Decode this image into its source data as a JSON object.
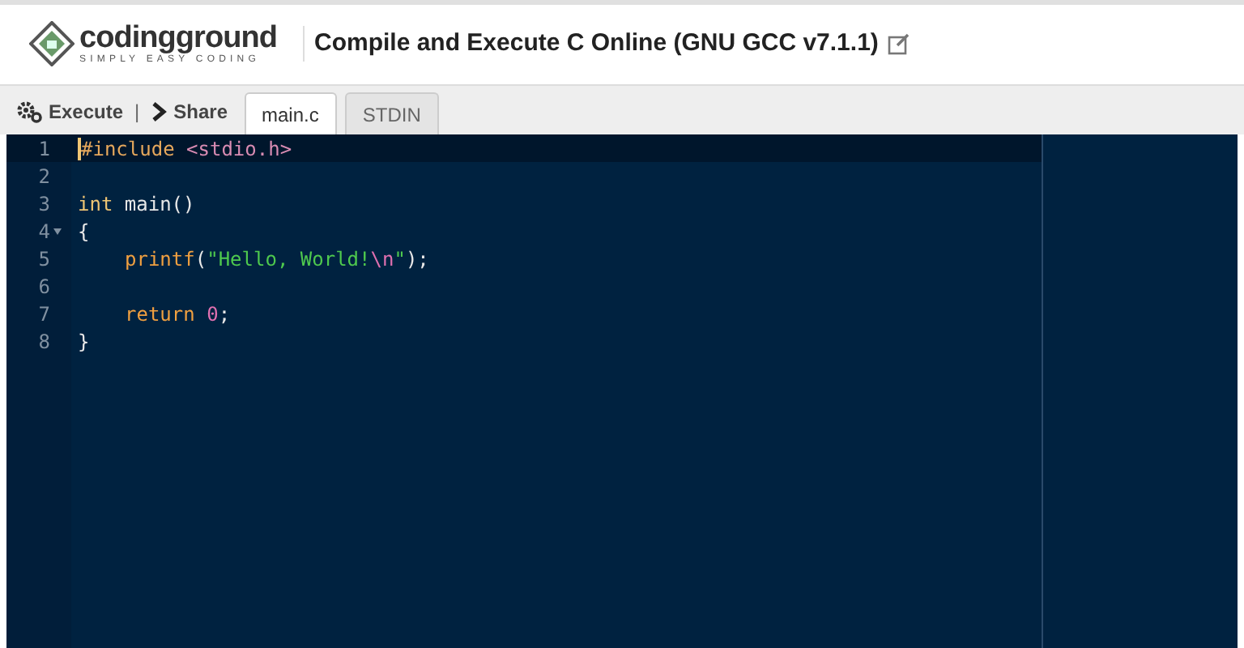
{
  "header": {
    "logo_name": "codingground",
    "logo_tagline": "SIMPLY EASY CODING",
    "title": "Compile and Execute C Online (GNU GCC v7.1.1)"
  },
  "toolbar": {
    "actions": [
      {
        "label": "Execute",
        "kind": "execute"
      },
      {
        "label": "Share",
        "kind": "share"
      }
    ],
    "separator": "|",
    "tabs": [
      {
        "label": "main.c",
        "selected": true
      },
      {
        "label": "STDIN",
        "selected": false
      }
    ]
  },
  "editor": {
    "lines": [
      {
        "number": "1",
        "active": true,
        "foldable": false,
        "indented": false,
        "tokens": [
          {
            "kind": "preprocessor",
            "text": "#include"
          },
          {
            "kind": "header",
            "text": " <stdio.h>"
          }
        ]
      },
      {
        "number": "2",
        "active": false,
        "foldable": false
      },
      {
        "number": "3",
        "active": false,
        "foldable": false,
        "indented": false,
        "tokens": [
          {
            "kind": "type",
            "text": "int"
          },
          {
            "kind": "plain",
            "text": " main()"
          }
        ]
      },
      {
        "number": "4",
        "active": false,
        "foldable": true,
        "indented": false,
        "tokens": [
          {
            "kind": "plain",
            "text": "{"
          }
        ]
      },
      {
        "number": "5",
        "active": false,
        "foldable": false,
        "indented": true,
        "tokens": [
          {
            "kind": "function",
            "text": "printf"
          },
          {
            "kind": "plain",
            "text": "("
          },
          {
            "kind": "string",
            "text": "\"Hello, World!"
          },
          {
            "kind": "escape",
            "text": "\\n"
          },
          {
            "kind": "string",
            "text": "\""
          },
          {
            "kind": "plain",
            "text": ");"
          }
        ]
      },
      {
        "number": "6",
        "active": false,
        "foldable": false
      },
      {
        "number": "7",
        "active": false,
        "foldable": false,
        "indented": true,
        "tokens": [
          {
            "kind": "keyword",
            "text": "return"
          },
          {
            "kind": "number",
            "text": " 0"
          },
          {
            "kind": "plain",
            "text": ";"
          }
        ]
      },
      {
        "number": "8",
        "active": false,
        "foldable": false,
        "indented": false,
        "tokens": [
          {
            "kind": "plain",
            "text": "}"
          }
        ]
      }
    ]
  }
}
